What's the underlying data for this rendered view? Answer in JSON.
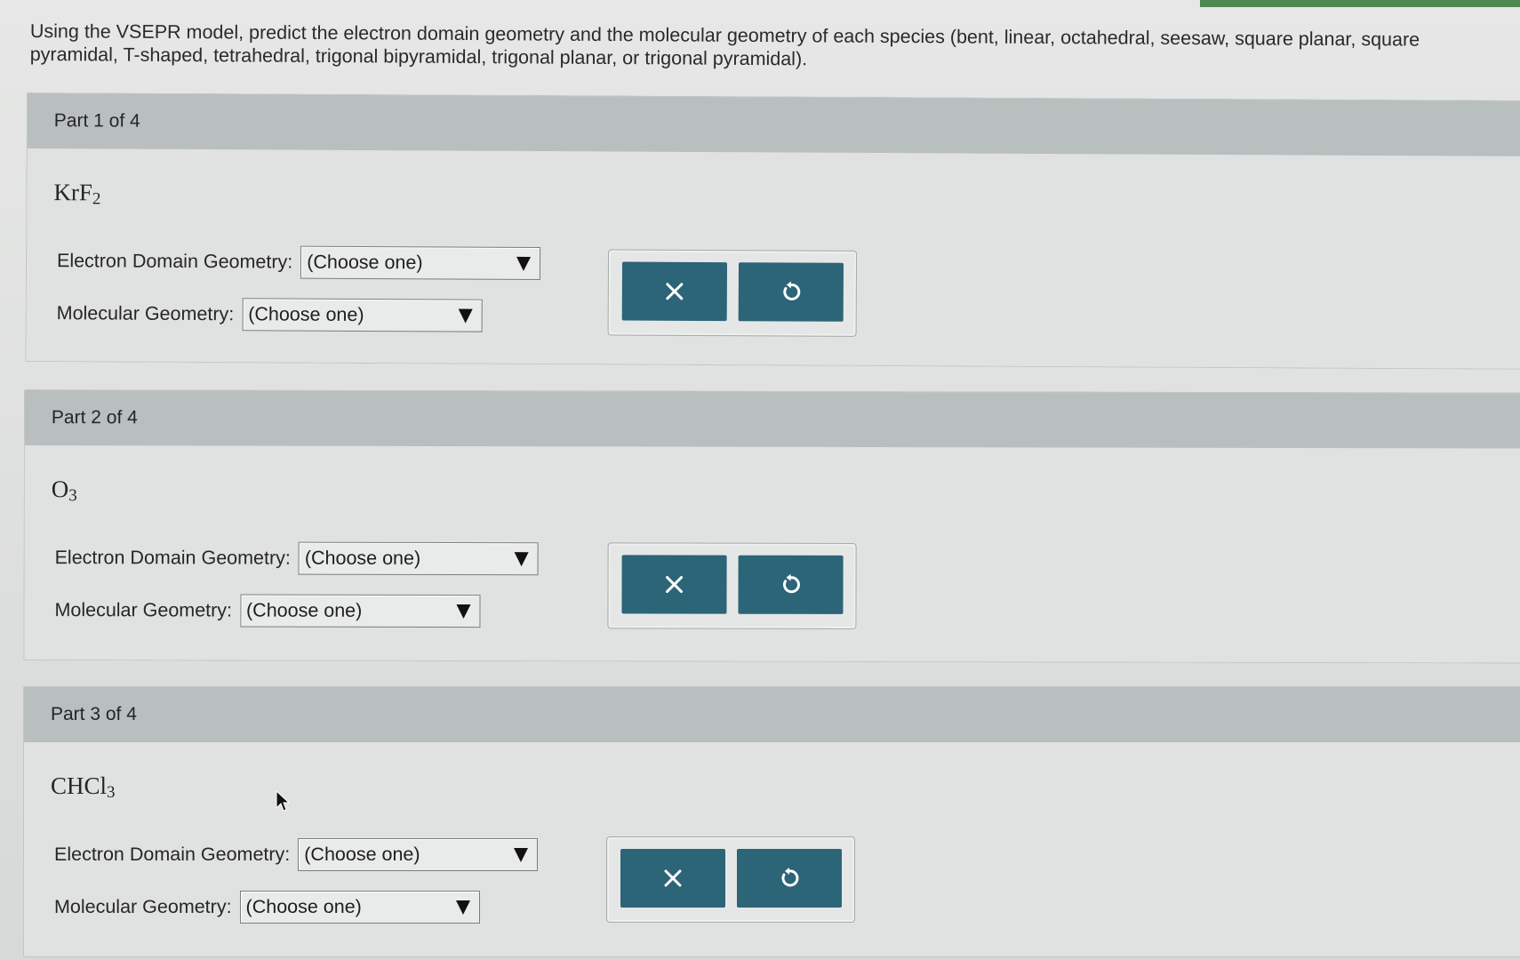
{
  "instructions": "Using the VSEPR model, predict the electron domain geometry and the molecular geometry of each species (bent, linear, octahedral, seesaw, square planar, square pyramidal, T-shaped, tetrahedral, trigonal bipyramidal, trigonal planar, or trigonal pyramidal).",
  "labels": {
    "electron_domain": "Electron Domain Geometry:",
    "molecular": "Molecular Geometry:"
  },
  "parts": [
    {
      "header": "Part 1 of 4",
      "species_base": "KrF",
      "species_sub": "2",
      "electron_domain_value": "(Choose one)",
      "molecular_value": "(Choose one)"
    },
    {
      "header": "Part 2 of 4",
      "species_base": "O",
      "species_sub": "3",
      "electron_domain_value": "(Choose one)",
      "molecular_value": "(Choose one)"
    },
    {
      "header": "Part 3 of 4",
      "species_base": "CHCl",
      "species_sub": "3",
      "electron_domain_value": "(Choose one)",
      "molecular_value": "(Choose one)"
    }
  ],
  "icons": {
    "clear": "close-icon",
    "reset": "undo-icon",
    "dropdown": "triangle-down-icon",
    "pointer": "mouse-cursor-icon"
  },
  "colors": {
    "button": "#2c6478",
    "header": "#b9bebf",
    "accent_strip": "#4f8a52"
  }
}
